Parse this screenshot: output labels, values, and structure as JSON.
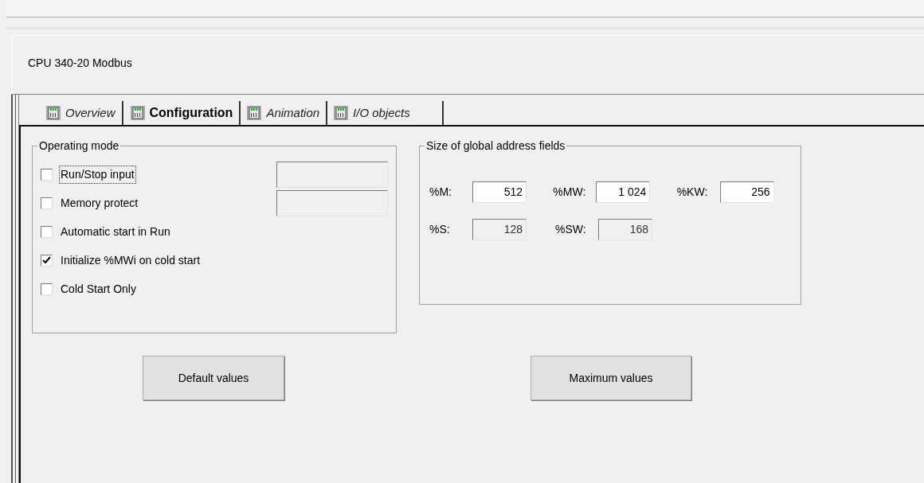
{
  "header": {
    "title": "CPU 340-20 Modbus"
  },
  "tabs": [
    {
      "label": "Overview",
      "selected": false
    },
    {
      "label": "Configuration",
      "selected": true
    },
    {
      "label": "Animation",
      "selected": false
    },
    {
      "label": "I/O objects",
      "selected": false
    }
  ],
  "operating_mode": {
    "title": "Operating mode",
    "options": [
      {
        "label": "Run/Stop input",
        "checked": false,
        "focused": true,
        "field": {
          "disabled": true
        }
      },
      {
        "label": "Memory protect",
        "checked": false,
        "focused": false,
        "field": {
          "disabled": true
        }
      },
      {
        "label": "Automatic start in Run",
        "checked": false,
        "focused": false
      },
      {
        "label": "Initialize %MWi on cold start",
        "checked": true,
        "focused": false
      },
      {
        "label": "Cold Start Only",
        "checked": false,
        "focused": false
      }
    ]
  },
  "address_fields": {
    "title": "Size of global address fields",
    "rows": [
      [
        {
          "label": "%M:",
          "value": "512",
          "disabled": false
        },
        {
          "label": "%MW:",
          "value": "1 024",
          "disabled": false
        },
        {
          "label": "%KW:",
          "value": "256",
          "disabled": false
        }
      ],
      [
        {
          "label": "%S:",
          "value": "128",
          "disabled": true
        },
        {
          "label": "%SW:",
          "value": "168",
          "disabled": true
        }
      ]
    ]
  },
  "buttons": [
    "Default values",
    "Maximum values"
  ]
}
